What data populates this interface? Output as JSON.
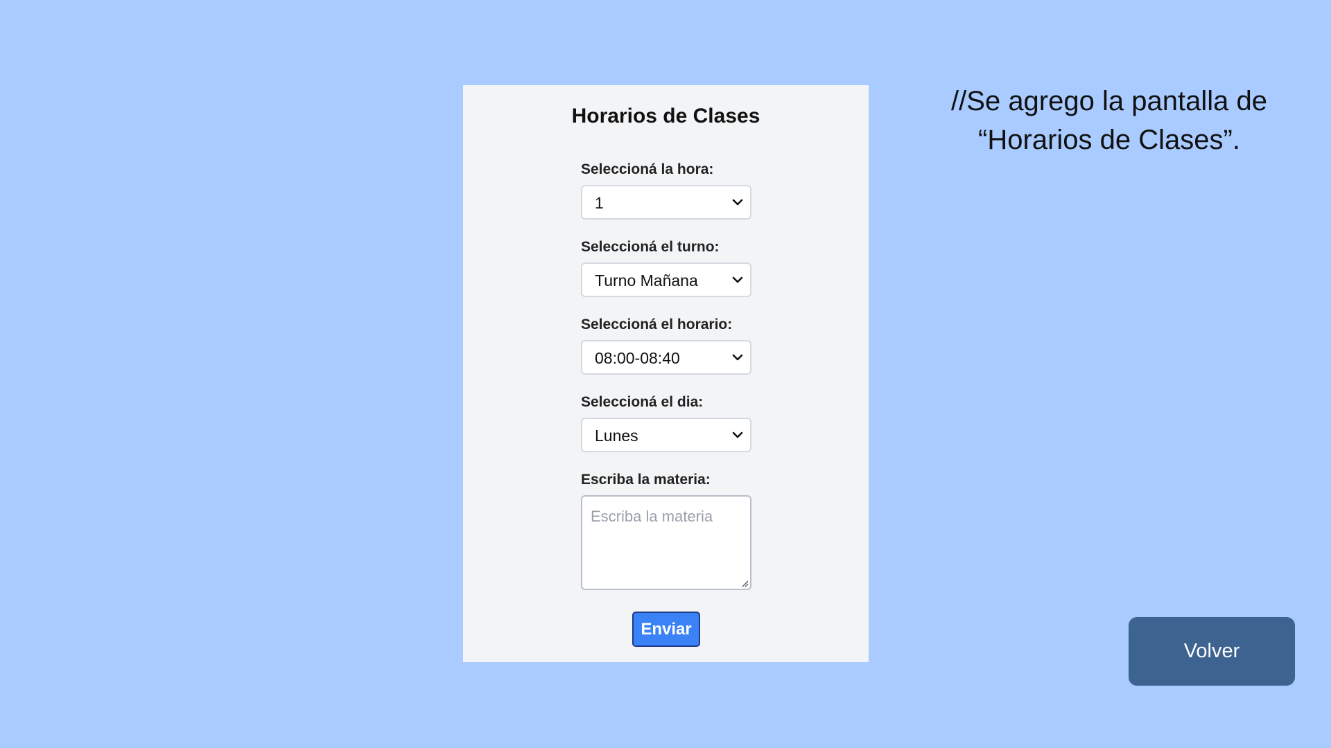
{
  "form": {
    "title": "Horarios de Clases",
    "hora": {
      "label": "Seleccioná la hora:",
      "value": "1"
    },
    "turno": {
      "label": "Seleccioná el turno:",
      "value": "Turno Mañana"
    },
    "horario": {
      "label": "Seleccioná el horario:",
      "value": "08:00-08:40"
    },
    "dia": {
      "label": "Seleccioná el dia:",
      "value": "Lunes"
    },
    "materia": {
      "label": "Escriba la materia:",
      "placeholder": "Escriba la materia",
      "value": ""
    },
    "submit_label": "Enviar"
  },
  "note": {
    "line1": "//Se agrego la pantalla de",
    "line2": "“Horarios de Clases”."
  },
  "back_button": {
    "label": "Volver"
  },
  "icons": {
    "select": "chevron-down-icon",
    "textarea": "resize-grip-icon"
  },
  "colors": {
    "background": "#a9cbff",
    "card": "#f3f4f6",
    "submit": "#3b82f6",
    "back_button": "#3d6490"
  }
}
